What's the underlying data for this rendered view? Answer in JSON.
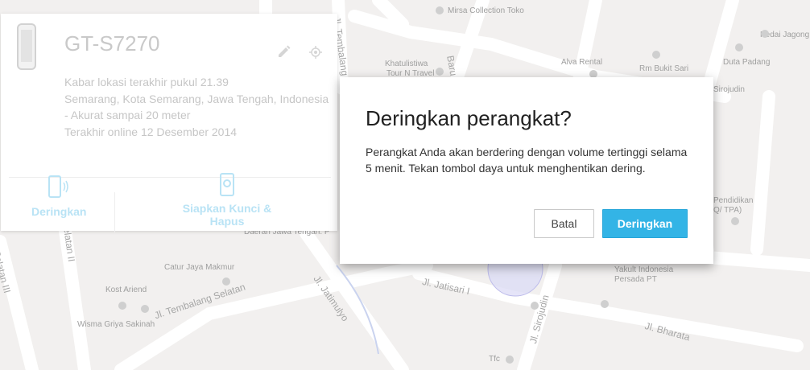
{
  "map": {
    "labels": {
      "mirsa": "Mirsa Collection Toko",
      "kedai": "Kedai Jagong",
      "khatulistiwa": "Khatulistiwa",
      "tour": "Tour N Travel",
      "alva": "Alva Rental",
      "bukitsari": "Rm Bukit Sari",
      "dutapadang": "Duta Padang",
      "sirojudin_top": "Sirojudin",
      "pendidikan": "Pendidikan",
      "tpa": "Q/ TPA)",
      "daerah": "Daerah Jawa Tengah. P",
      "caturjaya": "Catur Jaya Makmur",
      "kost": "Kost Ariend",
      "wisma": "Wisma Griya Sakinah",
      "yakult1": "Yakult Indonesia",
      "yakult2": "Persada PT",
      "tfc": "Tfc",
      "baru": "Baru"
    },
    "streets": {
      "tembalang_selatan": "Jl. Tembalang Selatan",
      "jatimulyo": "Jl. Jatimulyo",
      "jatisari": "Jl. Jatisari I",
      "sirojudin": "Jl. Sirojudin",
      "bharata": "Jl. Bharata",
      "selatan_iii": "Selatan III",
      "tembalang_ii": "Jl. Tembalang",
      "selatan_ii": "elatan II"
    }
  },
  "device": {
    "name": "GT-S7270",
    "location_line1": "Kabar lokasi terakhir pukul 21.39",
    "location_line2": "Semarang, Kota Semarang, Jawa Tengah, Indonesia",
    "location_line3": "- Akurat sampai 20 meter",
    "last_online": "Terakhir online 12 Desember 2014",
    "ring_label": "Deringkan",
    "lock_erase_label": "Siapkan Kunci & Hapus"
  },
  "dialog": {
    "title": "Deringkan perangkat?",
    "body": "Perangkat Anda akan berdering dengan volume tertinggi selama 5 menit. Tekan tombol daya untuk menghentikan dering.",
    "cancel_label": "Batal",
    "confirm_label": "Deringkan"
  },
  "colors": {
    "accent": "#33b4e6",
    "accent_light": "#b9e3f5",
    "location_circle": "#c9c8f0"
  }
}
